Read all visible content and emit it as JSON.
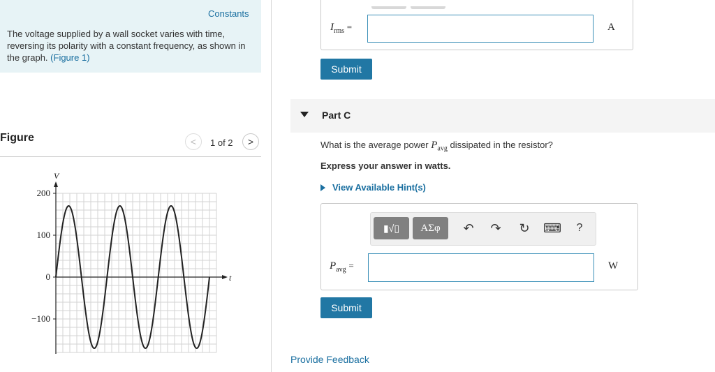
{
  "constants_link": "Constants",
  "intro": {
    "text": "The voltage supplied by a wall socket varies with time, reversing its polarity with a constant frequency, as shown in the graph.",
    "figure_link": "(Figure 1)"
  },
  "figure": {
    "title": "Figure",
    "counter": "1 of 2"
  },
  "chart_data": {
    "type": "line",
    "title": "",
    "xlabel": "t",
    "ylabel": "V",
    "y_ticks": [
      "200",
      "100",
      "0",
      "−100"
    ],
    "ylim": [
      -170,
      200
    ],
    "grid": true,
    "series": [
      {
        "amplitude": 170,
        "cycles": 3,
        "shape": "sine"
      }
    ]
  },
  "part_b": {
    "var": "I",
    "sub": "rms",
    "eq": "=",
    "unit": "A",
    "submit": "Submit"
  },
  "part_c": {
    "title": "Part C",
    "question_pre": "What is the average power ",
    "question_var": "P",
    "question_sub": "avg",
    "question_post": " dissipated in the resistor?",
    "instruction": "Express your answer in watts.",
    "hint": "View Available Hint(s)",
    "toolbar": {
      "templates": "▮√▯",
      "greek": "ΑΣφ",
      "undo": "↶",
      "redo": "↷",
      "reset": "↻",
      "keyboard": "⌨",
      "help": "?"
    },
    "var": "P",
    "sub": "avg",
    "eq": "=",
    "unit": "W",
    "submit": "Submit"
  },
  "feedback": "Provide Feedback"
}
